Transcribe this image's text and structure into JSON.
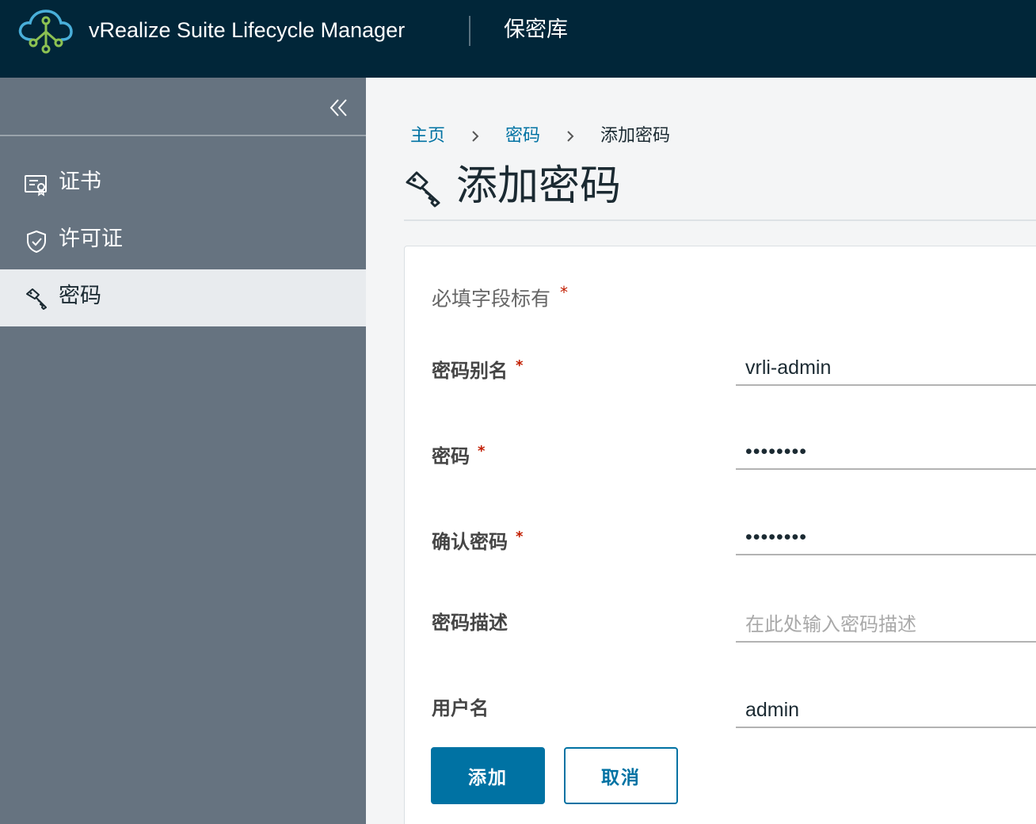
{
  "header": {
    "app_title": "vRealize Suite Lifecycle Manager",
    "section_title": "保密库",
    "logo_icon": "cloud-network-icon"
  },
  "sidebar": {
    "collapse_icon": "double-chevron-left-icon",
    "items": [
      {
        "label": "证书",
        "icon": "certificate-icon",
        "active": false
      },
      {
        "label": "许可证",
        "icon": "shield-check-icon",
        "active": false
      },
      {
        "label": "密码",
        "icon": "key-icon",
        "active": true
      }
    ]
  },
  "breadcrumb": {
    "home": "主页",
    "passwords": "密码",
    "current": "添加密码"
  },
  "page": {
    "title": "添加密码",
    "title_icon": "key-icon"
  },
  "form": {
    "required_note": "必填字段标有",
    "required_star": "*",
    "fields": [
      {
        "label": "密码别名",
        "required": true,
        "value": "vrli-admin",
        "placeholder": ""
      },
      {
        "label": "密码",
        "required": true,
        "value": "passwd12",
        "placeholder": ""
      },
      {
        "label": "确认密码",
        "required": true,
        "value": "passwd12",
        "placeholder": ""
      },
      {
        "label": "密码描述",
        "required": false,
        "value": "",
        "placeholder": "在此处输入密码描述"
      },
      {
        "label": "用户名",
        "required": false,
        "value": "admin",
        "placeholder": ""
      }
    ],
    "add_button": "添加",
    "cancel_button": "取消"
  },
  "colors": {
    "header_bg": "#012639",
    "sidebar_bg": "#667380",
    "accent": "#0072a3",
    "required": "#c21d00"
  }
}
